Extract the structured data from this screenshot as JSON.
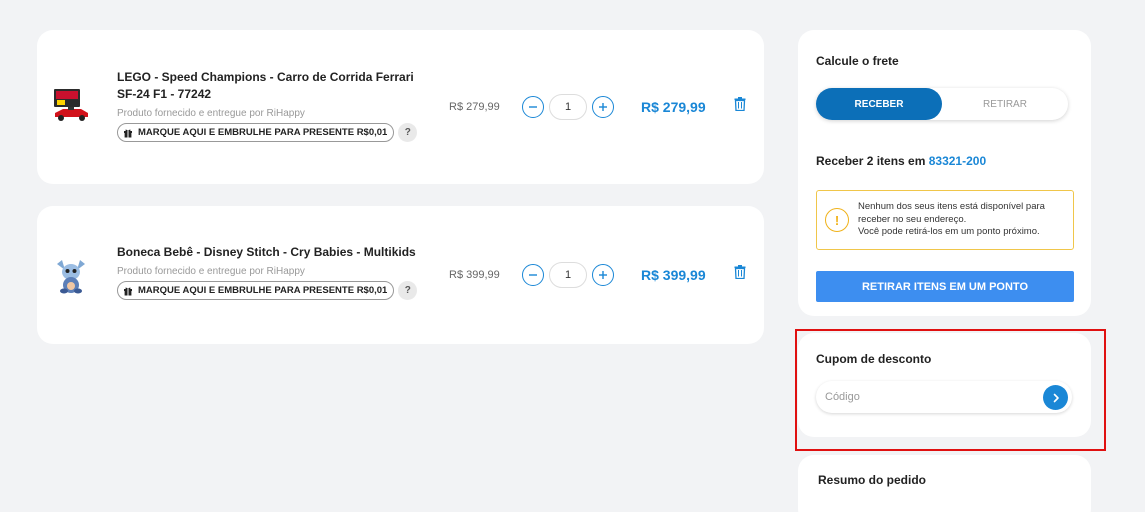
{
  "cart": {
    "items": [
      {
        "name": "LEGO - Speed Champions - Carro de Corrida Ferrari SF-24 F1 - 77242",
        "seller": "Produto fornecido e entregue por RiHappy",
        "gift_label": "MARQUE AQUI E EMBRULHE PARA PRESENTE R$0,01",
        "help_label": "?",
        "unit_price": "R$ 279,99",
        "quantity": "1",
        "total_price": "R$ 279,99",
        "image_icon": "lego-ferrari-car-icon"
      },
      {
        "name": "Boneca Bebê - Disney Stitch - Cry Babies - Multikids",
        "seller": "Produto fornecido e entregue por RiHappy",
        "gift_label": "MARQUE AQUI E EMBRULHE PARA PRESENTE R$0,01",
        "help_label": "?",
        "unit_price": "R$ 399,99",
        "quantity": "1",
        "total_price": "R$ 399,99",
        "image_icon": "stitch-doll-icon"
      }
    ]
  },
  "shipping": {
    "title": "Calcule o frete",
    "toggle_receive": "RECEBER",
    "toggle_pickup": "RETIRAR",
    "receive_prefix": "Receber 2 itens em",
    "zip": "83321-200",
    "alert_line1": "Nenhum dos seus itens está disponível para",
    "alert_line2": "receber no seu endereço.",
    "alert_line3": "Você pode retirá-los em um ponto próximo.",
    "pickup_button": "RETIRAR ITENS EM UM PONTO"
  },
  "coupon": {
    "title": "Cupom de desconto",
    "placeholder": "Código"
  },
  "summary": {
    "title": "Resumo do pedido"
  },
  "colors": {
    "accent": "#1a87d6",
    "toggle_active": "#0c6fb8",
    "button": "#3d8ef0",
    "alert_border": "#f0c64a",
    "highlight": "#e01010"
  }
}
